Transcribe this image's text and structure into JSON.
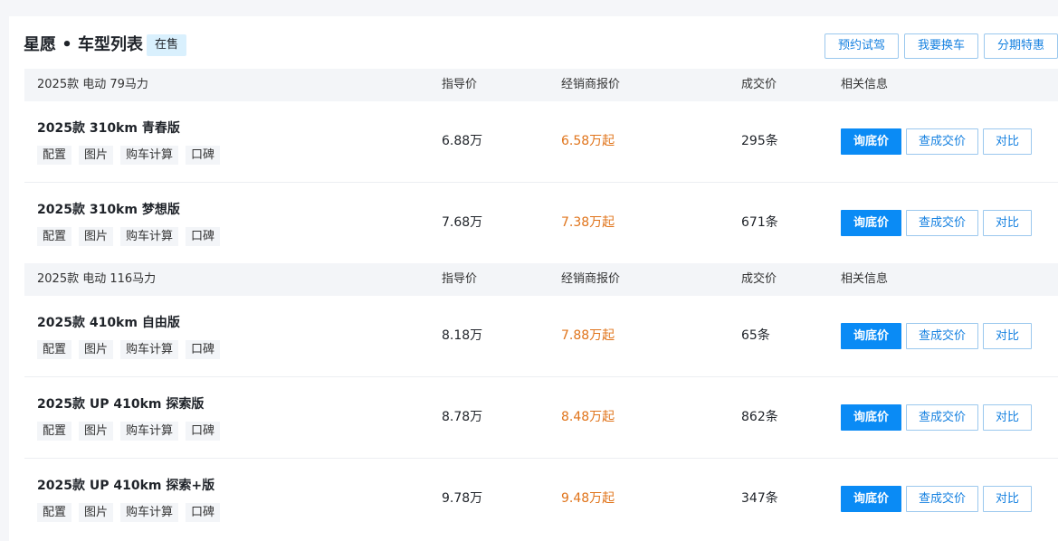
{
  "header": {
    "title": "星愿 • 车型列表",
    "status_badge": "在售",
    "actions": [
      "预约试驾",
      "我要换车",
      "分期特惠"
    ]
  },
  "columns": {
    "price": "指导价",
    "dealer": "经销商报价",
    "deal": "成交价",
    "info": "相关信息"
  },
  "row_buttons": {
    "ask": "询底价",
    "check": "查成交价",
    "compare": "对比"
  },
  "tags": [
    "配置",
    "图片",
    "购车计算",
    "口碑"
  ],
  "groups": [
    {
      "name": "2025款 电动 79马力",
      "models": [
        {
          "name": "2025款 310km 青春版",
          "price": "6.88万",
          "dealer": "6.58万起",
          "deals": "295条"
        },
        {
          "name": "2025款 310km 梦想版",
          "price": "7.68万",
          "dealer": "7.38万起",
          "deals": "671条"
        }
      ]
    },
    {
      "name": "2025款 电动 116马力",
      "models": [
        {
          "name": "2025款 410km 自由版",
          "price": "8.18万",
          "dealer": "7.88万起",
          "deals": "65条"
        },
        {
          "name": "2025款 UP 410km 探索版",
          "price": "8.78万",
          "dealer": "8.48万起",
          "deals": "862条"
        },
        {
          "name": "2025款 UP 410km 探索+版",
          "price": "9.78万",
          "dealer": "9.48万起",
          "deals": "347条"
        }
      ]
    }
  ],
  "colors": {
    "primary": "#0a8bf5",
    "dealer_price": "#e0741b",
    "badge_bg": "#d9f0fd"
  }
}
